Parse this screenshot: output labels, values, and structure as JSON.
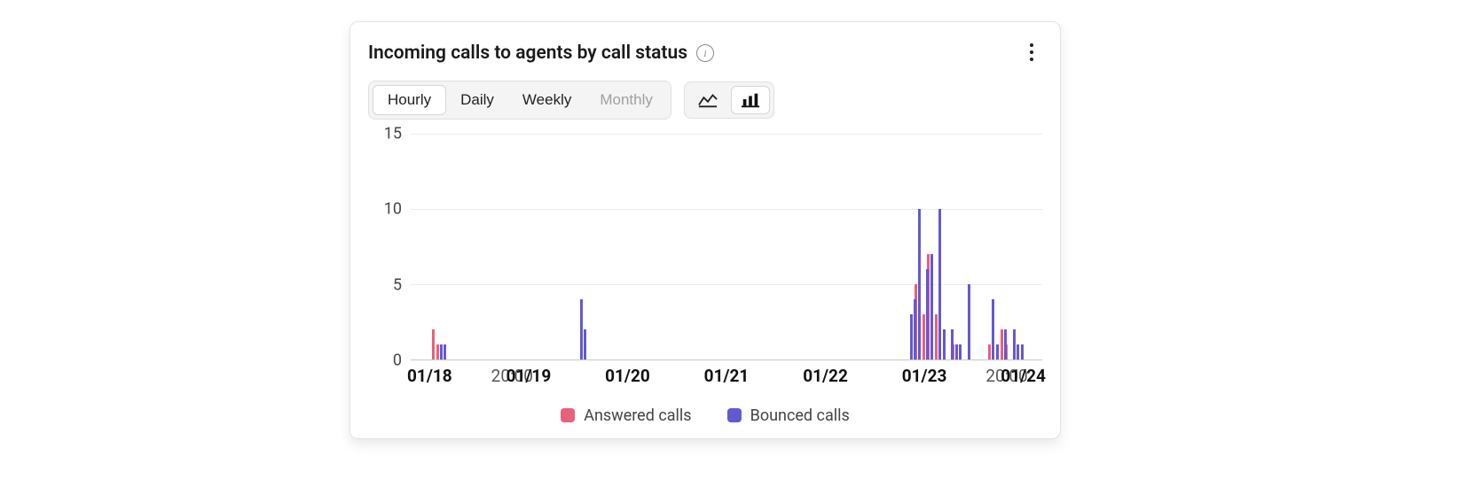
{
  "card": {
    "title": "Incoming calls to agents by call status"
  },
  "controls": {
    "granularity": {
      "options": [
        "Hourly",
        "Daily",
        "Weekly",
        "Monthly"
      ],
      "selected": "Hourly",
      "disabled": [
        "Monthly"
      ]
    },
    "chartType": {
      "options": [
        "line",
        "bar"
      ],
      "selected": "bar"
    }
  },
  "chart_data": {
    "type": "bar",
    "title": "Incoming calls to agents by call status",
    "xlabel": "",
    "ylabel": "",
    "ylim": [
      0,
      15
    ],
    "yticks": [
      0,
      5,
      10,
      15
    ],
    "x_total_hours": 144,
    "x_ticks": [
      {
        "label": "01/18",
        "hour": 0,
        "major": true
      },
      {
        "label": "20:00",
        "hour": 20,
        "major": false
      },
      {
        "label": "01/19",
        "hour": 24,
        "major": true
      },
      {
        "label": "01/20",
        "hour": 48,
        "major": true
      },
      {
        "label": "01/21",
        "hour": 72,
        "major": true
      },
      {
        "label": "01/22",
        "hour": 96,
        "major": true
      },
      {
        "label": "01/23",
        "hour": 120,
        "major": true
      },
      {
        "label": "20:00",
        "hour": 140,
        "major": false
      },
      {
        "label": "01/24",
        "hour": 144,
        "major": true
      }
    ],
    "series": [
      {
        "name": "Answered calls",
        "color": "#e8607a",
        "points": [
          {
            "hour": 1,
            "value": 2
          },
          {
            "hour": 2,
            "value": 1
          },
          {
            "hour": 37,
            "value": 1
          },
          {
            "hour": 117,
            "value": 3
          },
          {
            "hour": 118,
            "value": 5
          },
          {
            "hour": 120,
            "value": 3
          },
          {
            "hour": 121,
            "value": 7
          },
          {
            "hour": 123,
            "value": 3
          },
          {
            "hour": 125,
            "value": 1
          },
          {
            "hour": 127,
            "value": 1
          },
          {
            "hour": 128,
            "value": 1
          },
          {
            "hour": 136,
            "value": 1
          },
          {
            "hour": 139,
            "value": 2
          },
          {
            "hour": 140,
            "value": 1
          },
          {
            "hour": 142,
            "value": 1
          }
        ]
      },
      {
        "name": "Bounced calls",
        "color": "#6558d3",
        "points": [
          {
            "hour": 2,
            "value": 1
          },
          {
            "hour": 3,
            "value": 1
          },
          {
            "hour": 36,
            "value": 4
          },
          {
            "hour": 37,
            "value": 2
          },
          {
            "hour": 116,
            "value": 3
          },
          {
            "hour": 117,
            "value": 4
          },
          {
            "hour": 118,
            "value": 10
          },
          {
            "hour": 120,
            "value": 6
          },
          {
            "hour": 121,
            "value": 7
          },
          {
            "hour": 123,
            "value": 10
          },
          {
            "hour": 124,
            "value": 2
          },
          {
            "hour": 126,
            "value": 2
          },
          {
            "hour": 127,
            "value": 1
          },
          {
            "hour": 128,
            "value": 1
          },
          {
            "hour": 130,
            "value": 5
          },
          {
            "hour": 136,
            "value": 4
          },
          {
            "hour": 137,
            "value": 1
          },
          {
            "hour": 139,
            "value": 2
          },
          {
            "hour": 141,
            "value": 2
          },
          {
            "hour": 142,
            "value": 1
          },
          {
            "hour": 143,
            "value": 1
          }
        ]
      }
    ],
    "legend": [
      "Answered calls",
      "Bounced calls"
    ]
  }
}
